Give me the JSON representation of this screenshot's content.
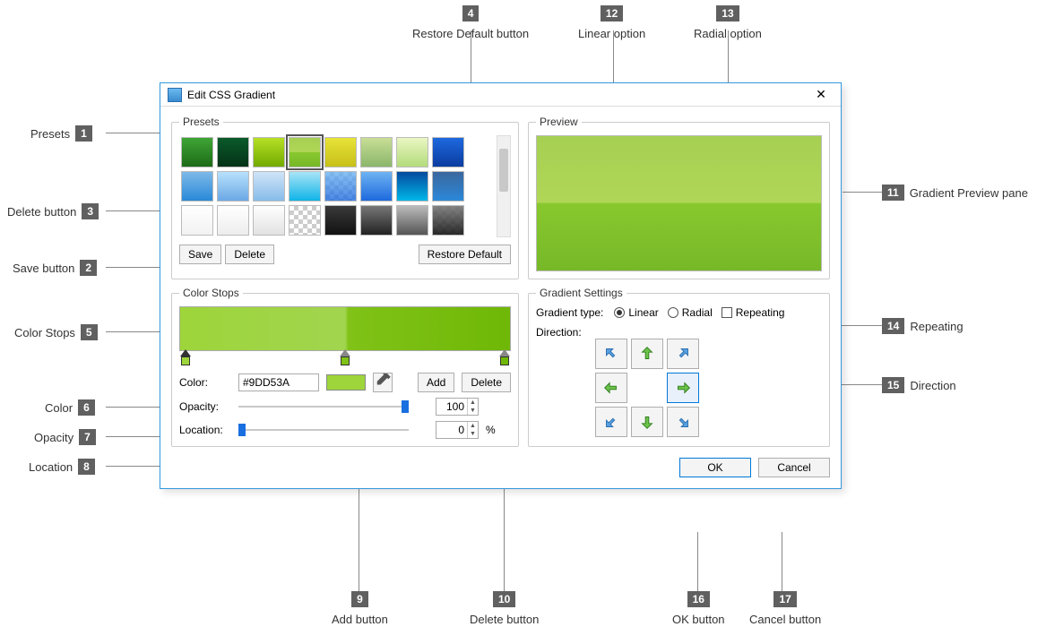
{
  "dialog": {
    "title": "Edit CSS Gradient",
    "close": "✕"
  },
  "presets": {
    "legend": "Presets",
    "save": "Save",
    "delete": "Delete",
    "restore": "Restore Default"
  },
  "preview": {
    "legend": "Preview"
  },
  "colorstops": {
    "legend": "Color Stops",
    "color_label": "Color:",
    "color_value": "#9DD53A",
    "opacity_label": "Opacity:",
    "opacity_value": "100",
    "location_label": "Location:",
    "location_value": "0",
    "percent": "%",
    "add": "Add",
    "delete": "Delete"
  },
  "settings": {
    "legend": "Gradient Settings",
    "type_label": "Gradient type:",
    "linear": "Linear",
    "radial": "Radial",
    "repeating": "Repeating",
    "direction_label": "Direction:"
  },
  "footer": {
    "ok": "OK",
    "cancel": "Cancel"
  },
  "callouts": {
    "c1": "Presets",
    "c2": "Save button",
    "c3": "Delete button",
    "c4": "Restore Default button",
    "c5": "Color Stops",
    "c6": "Color",
    "c7": "Opacity",
    "c8": "Location",
    "c9": "Add button",
    "c10": "Delete button",
    "c11": "Gradient Preview pane",
    "c12": "Linear option",
    "c13": "Radial option",
    "c14": "Repeating",
    "c15": "Direction",
    "c16": "OK button",
    "c17": "Cancel button"
  }
}
